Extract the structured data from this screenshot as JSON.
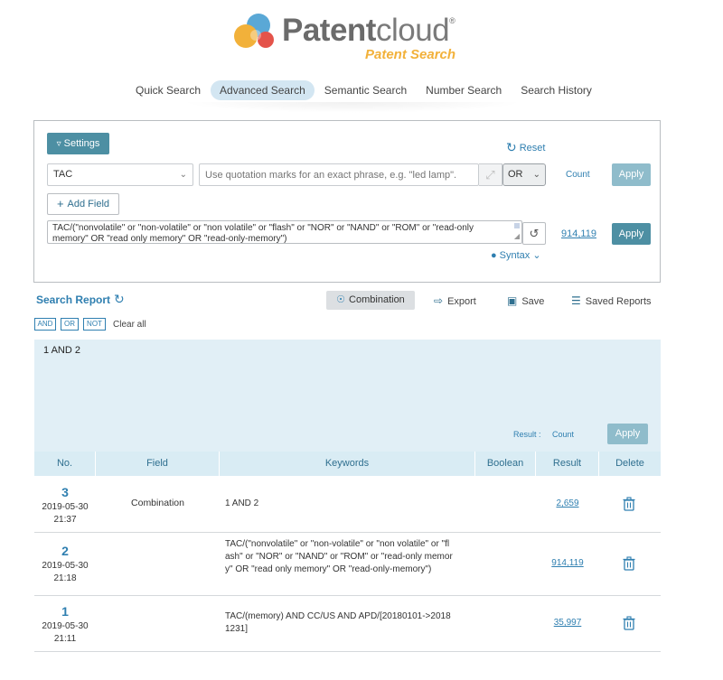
{
  "brand": {
    "name_bold": "Patent",
    "name_light": "cloud",
    "registered": "®",
    "subtitle": "Patent Search",
    "colors": {
      "orange": "#f2b13a",
      "blue": "#5aa8d6",
      "red": "#e4534a",
      "gray": "#6b6b6b"
    }
  },
  "tabs": [
    {
      "label": "Quick Search",
      "active": false
    },
    {
      "label": "Advanced Search",
      "active": true
    },
    {
      "label": "Semantic Search",
      "active": false
    },
    {
      "label": "Number Search",
      "active": false
    },
    {
      "label": "Search History",
      "active": false
    }
  ],
  "query_panel": {
    "settings_label": "Settings",
    "reset_label": "Reset",
    "field_value": "TAC",
    "keyword_placeholder": "Use quotation marks for an exact phrase, e.g. \"led lamp\".",
    "boolean_value": "OR",
    "count_label": "Count",
    "apply_label": "Apply",
    "add_field_label": "Add Field",
    "query_text": "TAC/(\"nonvolatile\" or \"non-volatile\" or \"non volatile\" or \"flash\" or \"NOR\" or \"NAND\" or \"ROM\" or \"read-only memory\" OR \"read only memory\" OR \"read-only-memory\")",
    "query_result": "914,119",
    "query_apply_label": "Apply",
    "syntax_label": "Syntax"
  },
  "report": {
    "title": "Search Report",
    "combination_label": "Combination",
    "export_label": "Export",
    "save_label": "Save",
    "saved_reports_label": "Saved Reports",
    "ops": {
      "and": "AND",
      "or": "OR",
      "not": "NOT"
    },
    "clear_all_label": "Clear all",
    "combination_text": "1 AND 2",
    "result_label": "Result :",
    "count_label": "Count",
    "apply_label": "Apply"
  },
  "table": {
    "headers": {
      "no": "No.",
      "field": "Field",
      "keywords": "Keywords",
      "boolean": "Boolean",
      "result": "Result",
      "delete": "Delete"
    },
    "rows": [
      {
        "no": "3",
        "date": "2019-05-30",
        "time": "21:37",
        "field": "Combination",
        "keywords": "1 AND 2",
        "boolean": "",
        "result": "2,659"
      },
      {
        "no": "2",
        "date": "2019-05-30",
        "time": "21:18",
        "field": "",
        "keywords": "TAC/(\"nonvolatile\" or \"non-volatile\" or \"non volatile\" or \"flash\" or \"NOR\" or \"NAND\" or \"ROM\" or \"read-only memory\" OR \"read only memory\" OR \"read-only-memory\")",
        "boolean": "",
        "result": "914,119"
      },
      {
        "no": "1",
        "date": "2019-05-30",
        "time": "21:11",
        "field": "",
        "keywords": "TAC/(memory) AND CC/US AND APD/[20180101->20181231]",
        "boolean": "",
        "result": "35,997"
      }
    ]
  }
}
